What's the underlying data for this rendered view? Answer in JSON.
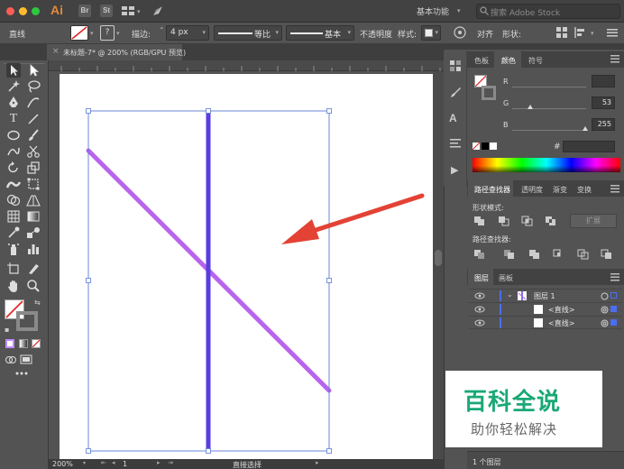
{
  "app": {
    "logo": "Ai",
    "icon_br": "Br",
    "icon_st": "St"
  },
  "titlebar": {
    "workspace": "基本功能",
    "stock_placeholder": "搜索 Adobe Stock"
  },
  "controlbar": {
    "object_type": "直线",
    "stroke_label": "描边:",
    "stroke_value": "4 px",
    "profile_label": "等比",
    "brush_label": "基本",
    "opacity_label": "不透明度",
    "style_label": "样式:",
    "align_label": "对齐",
    "shape_label": "形状:"
  },
  "document_tab": {
    "close_glyph": "×",
    "title": "未标题-7* @ 200% (RGB/GPU 预览)"
  },
  "statusbar": {
    "zoom": "200%",
    "page": "1",
    "tool": "直接选择"
  },
  "color_panel": {
    "tabs": [
      "色板",
      "颜色",
      "符号"
    ],
    "active_tab": "颜色",
    "channels": [
      {
        "label": "R",
        "value": ""
      },
      {
        "label": "G",
        "value": "53"
      },
      {
        "label": "B",
        "value": "255"
      }
    ],
    "hex_label": "#"
  },
  "pathfinder_panel": {
    "tabs": [
      "路径查找器",
      "透明度",
      "渐变",
      "变换"
    ],
    "active_tab": "路径查找器",
    "shape_modes_label": "形状模式:",
    "expand_label": "扩展",
    "pathfinders_label": "路径查找器:"
  },
  "layers_panel": {
    "tabs": [
      "图层",
      "画板"
    ],
    "active_tab": "图层",
    "rows": [
      {
        "name": "图层 1"
      },
      {
        "name": "<直线>"
      },
      {
        "name": "<直线>"
      }
    ],
    "footer": "1 个图层"
  },
  "watermark": {
    "title": "百科全说",
    "subtitle": "助你轻松解决"
  },
  "colors": {
    "purple_line": "#b865ec",
    "blue_line": "#5a3de0",
    "arrow": "#e34234",
    "selection": "#5b7bd6",
    "watermark_green": "#1aa876"
  }
}
